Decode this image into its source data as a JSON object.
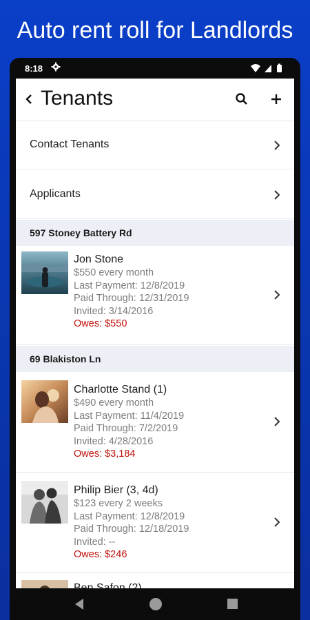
{
  "banner": {
    "text": "Auto rent roll for Landlords"
  },
  "status_bar": {
    "time": "8:18"
  },
  "app_bar": {
    "title": "Tenants",
    "back_icon": "chevron-left-icon",
    "search_icon": "search-icon",
    "add_icon": "plus-icon"
  },
  "menu": [
    {
      "label": "Contact Tenants"
    },
    {
      "label": "Applicants"
    }
  ],
  "properties": [
    {
      "address": "597 Stoney Battery Rd",
      "tenants": [
        {
          "name": "Jon Stone",
          "rent": "$550 every month",
          "last_payment": "Last Payment: 12/8/2019",
          "paid_through": "Paid Through: 12/31/2019",
          "invited": "Invited: 3/14/2016",
          "owes": "Owes: $550"
        }
      ]
    },
    {
      "address": "69 Blakiston Ln",
      "tenants": [
        {
          "name": "Charlotte Stand (1)",
          "rent": "$490 every month",
          "last_payment": "Last Payment: 11/4/2019",
          "paid_through": "Paid Through: 7/2/2019",
          "invited": "Invited: 4/28/2016",
          "owes": "Owes: $3,184"
        },
        {
          "name": "Philip Bier (3, 4d)",
          "rent": "$123 every 2 weeks",
          "last_payment": "Last Payment: 12/8/2019",
          "paid_through": "Paid Through: 12/18/2019",
          "invited": "Invited: --",
          "owes": "Owes: $246"
        },
        {
          "name": "Ben Safon (2)"
        }
      ]
    }
  ],
  "colors": {
    "banner_bg": "#0a3fc8",
    "owes": "#c0100a",
    "section_bg": "#eceff5"
  }
}
